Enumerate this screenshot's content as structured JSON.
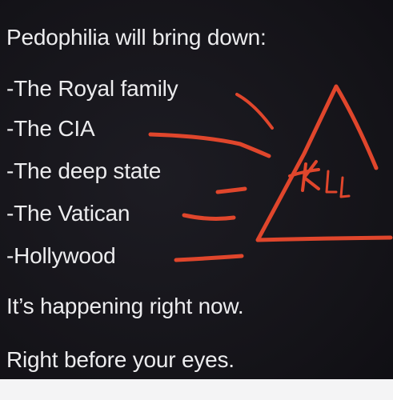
{
  "post": {
    "heading": "Pedophilia will bring down:",
    "items": [
      "-The Royal family",
      "-The CIA",
      "-The deep state",
      "-The Vatican",
      "-Hollywood"
    ],
    "closing_1": "It’s happening right now.",
    "closing_2": "Right before your eyes."
  },
  "annotation": {
    "handwritten_text": "KLL",
    "shape": "triangle",
    "color": "#e0462c"
  }
}
